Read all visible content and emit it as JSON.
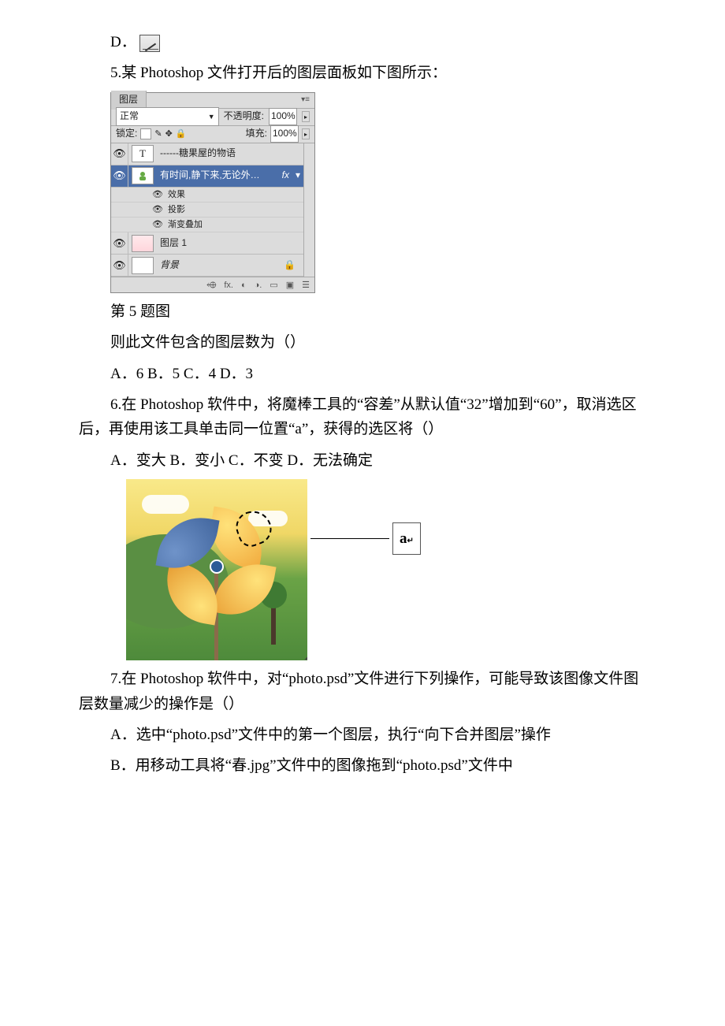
{
  "optD": {
    "prefix": "D．"
  },
  "q5": {
    "text": "5.某 Photoshop 文件打开后的图层面板如下图所示：",
    "caption": "第 5 题图",
    "stem": "则此文件包含的图层数为（）",
    "opts": "A．6 B．5 C．4 D．3"
  },
  "layers_panel": {
    "tab": "图层",
    "menu_glyph": "▾≡",
    "blend": "正常",
    "opacity_label": "不透明度:",
    "opacity_value": "100%",
    "lock_label": "锁定:",
    "fill_label": "填充:",
    "fill_value": "100%",
    "layer_text": "------糖果屋的物语",
    "layer_text_thumb": "T",
    "layer_sel": "有时间,静下来,无论外…",
    "layer_sel_thumb": "",
    "fx_label": "fx",
    "fx_header": "效果",
    "fx_shadow": "投影",
    "fx_grad": "渐变叠加",
    "layer1": "图层 1",
    "bg": "背景",
    "lock_glyph": "🔒",
    "eye": "👁",
    "footer_glyphs": [
      "⬲",
      "fx.",
      "◐",
      "◑.",
      "▭",
      "▣",
      "☰"
    ]
  },
  "q6": {
    "text": "6.在 Photoshop 软件中，将魔棒工具的“容差”从默认值“32”增加到“60”，取消选区后，再使用该工具单击同一位置“a”，获得的选区将（）",
    "opts": "A．变大 B．变小 C．不变 D．无法确定",
    "point_label": "a"
  },
  "q7": {
    "text": "7.在 Photoshop 软件中，对“photo.psd”文件进行下列操作，可能导致该图像文件图层数量减少的操作是（）",
    "optA": "A．选中“photo.psd”文件中的第一个图层，执行“向下合并图层”操作",
    "optB": "B．用移动工具将“春.jpg”文件中的图像拖到“photo.psd”文件中"
  }
}
